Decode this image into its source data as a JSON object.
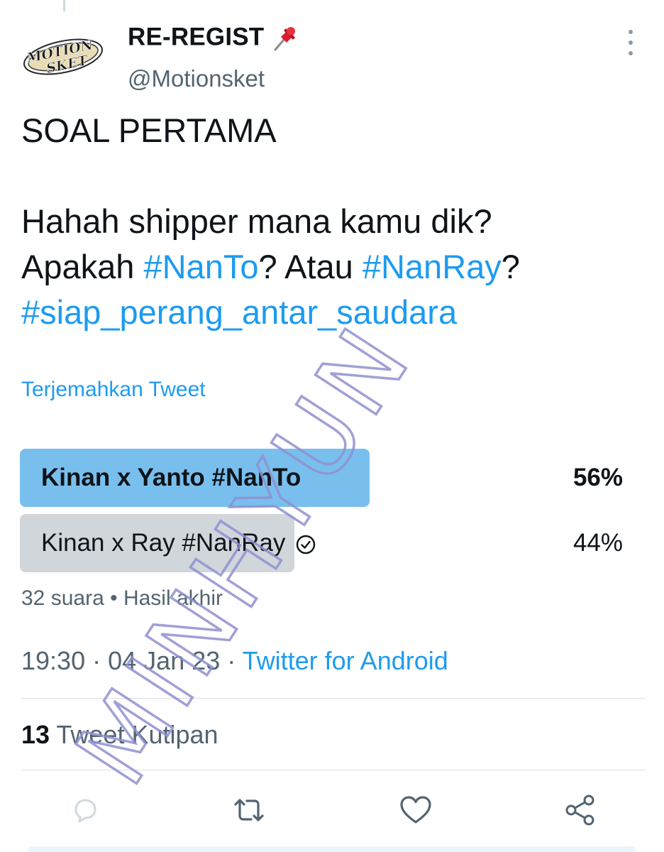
{
  "tweet": {
    "avatar_text_line1": "MOTION",
    "avatar_text_line2": "SKET",
    "display_name": "RE-REGIST",
    "handle": "@Motionsket",
    "text_line1": "SOAL PERTAMA",
    "text_line2": "Hahah shipper mana kamu dik?",
    "text_line3_pre": "Apakah ",
    "hashtag_nanto": "#NanTo",
    "text_line3_mid": "? Atau ",
    "hashtag_nanray": "#NanRay",
    "text_line3_post": "?",
    "hashtag_siap": "#siap_perang_antar_saudara",
    "translate_label": "Terjemahkan Tweet"
  },
  "poll": {
    "options": [
      {
        "label": "Kinan x Yanto #NanTo",
        "percent_label": "56%",
        "fraction": 0.56,
        "winner": true
      },
      {
        "label": "Kinan x Ray #NanRay",
        "percent_label": "44%",
        "fraction": 0.44,
        "winner": false,
        "user_voted": true
      }
    ],
    "votes": "32 suara",
    "separator": "•",
    "status": "Hasil akhir"
  },
  "meta": {
    "time": "19:30",
    "dot1": "·",
    "date": "04 Jan 23",
    "dot2": "·",
    "source": "Twitter for Android"
  },
  "stats": {
    "quote_count": "13",
    "quote_label": "Tweet Kutipan"
  },
  "actions": [
    "reply-icon",
    "retweet-icon",
    "like-icon",
    "share-icon"
  ],
  "watermark": {
    "text": "MINHYUN"
  },
  "colors": {
    "accent": "#1d9bf0",
    "winner_bar": "#79bfee",
    "loser_bar": "#d0d6da",
    "secondary_text": "#536471",
    "watermark": "#8f8fd0"
  }
}
